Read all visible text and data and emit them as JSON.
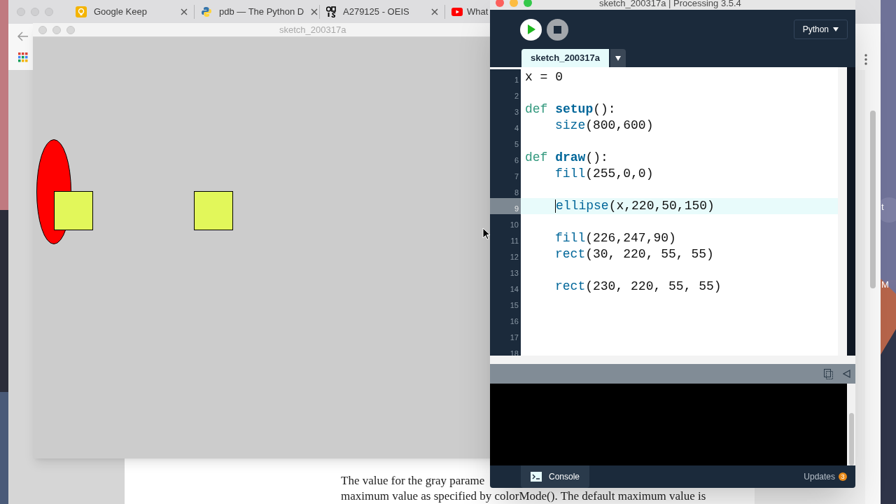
{
  "desktop": {
    "labels": [
      "t",
      "M"
    ]
  },
  "browser": {
    "tabs": [
      {
        "title": "Google Keep",
        "kind": "keep",
        "selected": false
      },
      {
        "title": "pdb — The Python D",
        "kind": "python",
        "selected": false
      },
      {
        "title": "A279125 - OEIS",
        "kind": "oeis",
        "selected": false
      },
      {
        "title": "What",
        "kind": "youtube",
        "selected": false
      }
    ],
    "document_lines": [
      "The value for the gray parame",
      "maximum value as specified by colorMode(). The default maximum value is"
    ]
  },
  "sketch_window": {
    "title": "sketch_200317a"
  },
  "ide": {
    "title": "sketch_200317a | Processing 3.5.4",
    "mode": "Python",
    "tabs": [
      {
        "label": "sketch_200317a",
        "selected": true
      }
    ],
    "lines": [
      {
        "number": "1",
        "selected": false,
        "indent": false,
        "tokens": [
          {
            "text": "x = 0",
            "kind": "plain"
          }
        ]
      },
      {
        "number": "2",
        "selected": false
      },
      {
        "number": "3",
        "selected": false,
        "indent": false,
        "tokens": [
          {
            "text": "def ",
            "kind": "keyword"
          },
          {
            "text": "setup",
            "kind": "definition"
          },
          {
            "text": "():",
            "kind": "plain"
          }
        ]
      },
      {
        "number": "4",
        "selected": false,
        "indent": true,
        "tokens": [
          {
            "text": "size",
            "kind": "function"
          },
          {
            "text": "(800,600)",
            "kind": "plain"
          }
        ]
      },
      {
        "number": "5",
        "selected": false
      },
      {
        "number": "6",
        "selected": false,
        "indent": false,
        "tokens": [
          {
            "text": "def ",
            "kind": "keyword"
          },
          {
            "text": "draw",
            "kind": "definition"
          },
          {
            "text": "():",
            "kind": "plain"
          }
        ]
      },
      {
        "number": "7",
        "selected": false,
        "indent": true,
        "tokens": [
          {
            "text": "fill",
            "kind": "function"
          },
          {
            "text": "(255,0,0)",
            "kind": "plain"
          }
        ]
      },
      {
        "number": "8",
        "selected": false
      },
      {
        "number": "9",
        "selected": true,
        "indent": true,
        "tokens": [
          {
            "text": "ellipse",
            "kind": "function"
          },
          {
            "text": "(x,220,50,150)",
            "kind": "plain"
          }
        ]
      },
      {
        "number": "10",
        "selected": false
      },
      {
        "number": "11",
        "selected": false,
        "indent": true,
        "tokens": [
          {
            "text": "fill",
            "kind": "function"
          },
          {
            "text": "(226,247,90)",
            "kind": "plain"
          }
        ]
      },
      {
        "number": "12",
        "selected": false,
        "indent": true,
        "tokens": [
          {
            "text": "rect",
            "kind": "function"
          },
          {
            "text": "(30, 220, 55, 55)",
            "kind": "plain"
          }
        ]
      },
      {
        "number": "13",
        "selected": false
      },
      {
        "number": "14",
        "selected": false,
        "indent": true,
        "tokens": [
          {
            "text": "rect",
            "kind": "function"
          },
          {
            "text": "(230, 220, 55, 55)",
            "kind": "plain"
          }
        ]
      },
      {
        "number": "15",
        "selected": false
      },
      {
        "number": "16",
        "selected": false
      },
      {
        "number": "17",
        "selected": false
      },
      {
        "number": "18",
        "selected": false
      }
    ],
    "console_tab": {
      "label": "Console",
      "selected": true
    },
    "updates": {
      "label": "Updates",
      "count": "3"
    }
  }
}
